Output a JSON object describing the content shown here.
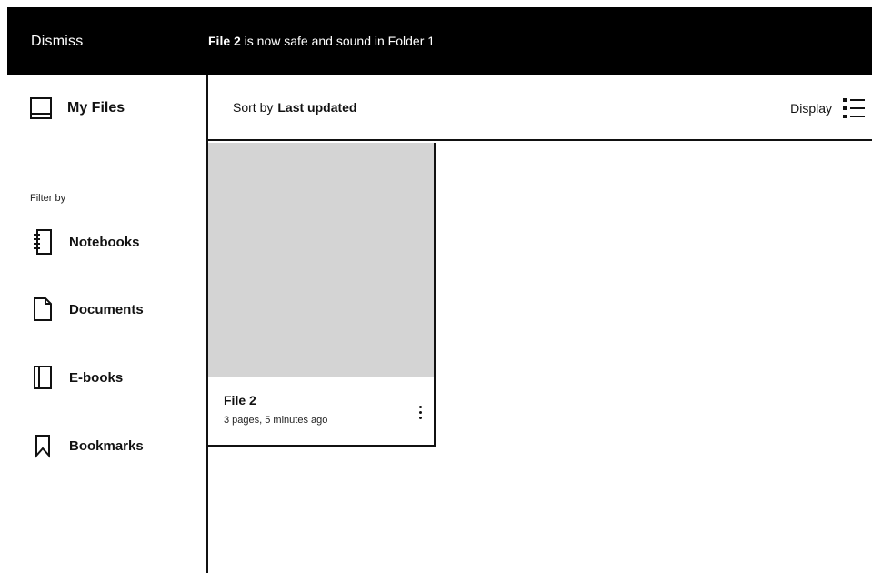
{
  "topbar": {
    "dismiss_label": "Dismiss",
    "toast_filename": "File 2",
    "toast_message": " is now safe and sound in Folder 1"
  },
  "sidebar": {
    "my_files_label": "My Files",
    "my_files_icon": "tablet-icon",
    "filter_title": "Filter by",
    "items": [
      {
        "label": "Notebooks",
        "icon": "notebook-icon"
      },
      {
        "label": "Documents",
        "icon": "document-icon"
      },
      {
        "label": "E-books",
        "icon": "ebook-icon"
      },
      {
        "label": "Bookmarks",
        "icon": "bookmark-icon"
      }
    ]
  },
  "sortbar": {
    "sort_prefix": "Sort by",
    "sort_value": "Last updated",
    "display_label": "Display",
    "display_icon": "list-view-icon"
  },
  "files": [
    {
      "title": "File 2",
      "meta": "3 pages, 5 minutes ago",
      "menu_icon": "more-vertical-icon"
    }
  ],
  "colors": {
    "topbar_bg": "#000000",
    "thumbnail_bg": "#d4d4d4",
    "text": "#111111"
  }
}
